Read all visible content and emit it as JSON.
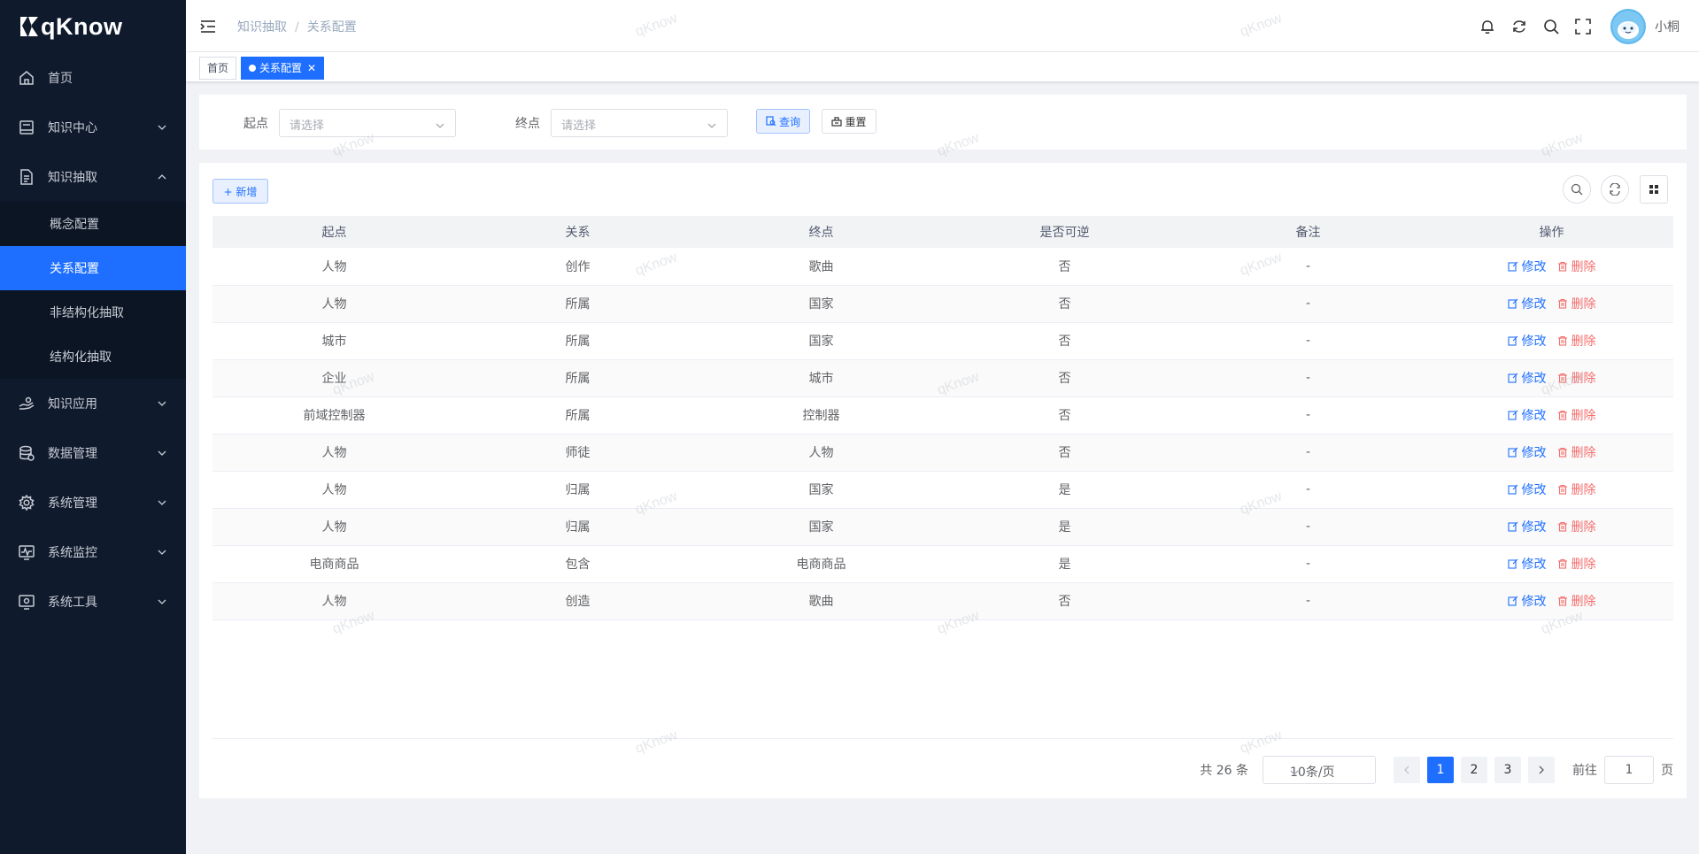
{
  "app": {
    "name": "qKnow"
  },
  "sidebar": {
    "items": [
      {
        "label": "首页"
      },
      {
        "label": "知识中心"
      },
      {
        "label": "知识抽取"
      },
      {
        "label": "知识应用"
      },
      {
        "label": "数据管理"
      },
      {
        "label": "系统管理"
      },
      {
        "label": "系统监控"
      },
      {
        "label": "系统工具"
      }
    ],
    "submenu": [
      {
        "label": "概念配置"
      },
      {
        "label": "关系配置"
      },
      {
        "label": "非结构化抽取"
      },
      {
        "label": "结构化抽取"
      }
    ]
  },
  "header": {
    "breadcrumb": [
      "知识抽取",
      "关系配置"
    ],
    "username": "小桐"
  },
  "tags": [
    {
      "label": "首页"
    },
    {
      "label": "关系配置"
    }
  ],
  "search": {
    "start_label": "起点",
    "start_placeholder": "请选择",
    "end_label": "终点",
    "end_placeholder": "请选择",
    "query_label": "查询",
    "reset_label": "重置"
  },
  "toolbar": {
    "add_label": "+ 新增"
  },
  "table": {
    "columns": [
      "起点",
      "关系",
      "终点",
      "是否可逆",
      "备注",
      "操作"
    ],
    "edit_label": "修改",
    "delete_label": "删除",
    "rows": [
      [
        "人物",
        "创作",
        "歌曲",
        "否",
        "-"
      ],
      [
        "人物",
        "所属",
        "国家",
        "否",
        "-"
      ],
      [
        "城市",
        "所属",
        "国家",
        "否",
        "-"
      ],
      [
        "企业",
        "所属",
        "城市",
        "否",
        "-"
      ],
      [
        "前域控制器",
        "所属",
        "控制器",
        "否",
        "-"
      ],
      [
        "人物",
        "师徒",
        "人物",
        "否",
        "-"
      ],
      [
        "人物",
        "归属",
        "国家",
        "是",
        "-"
      ],
      [
        "人物",
        "归属",
        "国家",
        "是",
        "-"
      ],
      [
        "电商商品",
        "包含",
        "电商商品",
        "是",
        "-"
      ],
      [
        "人物",
        "创造",
        "歌曲",
        "否",
        "-"
      ]
    ]
  },
  "pagination": {
    "total": "共 26 条",
    "page_size": "10条/页",
    "pages": [
      "1",
      "2",
      "3"
    ],
    "current": "1",
    "goto_label": "前往",
    "goto_value": "1",
    "page_suffix": "页"
  },
  "watermark": "qKnow",
  "colors": {
    "primary": "#1e6fff",
    "danger": "#f56c6c",
    "sidebar_bg": "#0f1b2d"
  }
}
